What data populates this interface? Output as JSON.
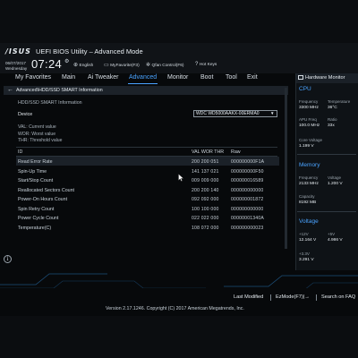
{
  "header": {
    "logo": "/ISUS",
    "title": "UEFI BIOS Utility – Advanced Mode",
    "date": "06/07/2017",
    "weekday": "Wednesday",
    "time": "07:24",
    "tools": [
      {
        "label": "English",
        "icon": "globe-icon"
      },
      {
        "label": "MyFavorite(F3)",
        "icon": "star-icon"
      },
      {
        "label": "Qfan Control(F6)",
        "icon": "fan-icon"
      },
      {
        "label": "Hot Keys",
        "icon": "question-icon"
      }
    ]
  },
  "menu": {
    "items": [
      "My Favorites",
      "Main",
      "Ai Tweaker",
      "Advanced",
      "Monitor",
      "Boot",
      "Tool",
      "Exit"
    ],
    "active": "Advanced"
  },
  "breadcrumb": "Advanced\\HDD/SSD SMART Information",
  "section_title": "HDD/SSD SMART Information",
  "device": {
    "label": "Device",
    "value": "WDC WD5000AAKX-00ERMA0"
  },
  "legend": [
    "VAL: Current value",
    "WOR: Worst value",
    "THR: Threshold value"
  ],
  "table": {
    "headers": {
      "id": "ID",
      "vals": "VAL WOR THR",
      "raw": "Raw"
    },
    "rows": [
      {
        "name": "Read Error Rate",
        "vals": "200 200 051",
        "raw": "000000000F1A"
      },
      {
        "name": "Spin-Up Time",
        "vals": "141 137 021",
        "raw": "000000000F50"
      },
      {
        "name": "Start/Stop Count",
        "vals": "009 009 000",
        "raw": "000000016589"
      },
      {
        "name": "Reallocated Sectors Count",
        "vals": "200 200 140",
        "raw": "000000000000"
      },
      {
        "name": "Power-On Hours Count",
        "vals": "092 092 000",
        "raw": "000000001872"
      },
      {
        "name": "Spin Retry Count",
        "vals": "100 100 000",
        "raw": "000000000000"
      },
      {
        "name": "Power Cycle Count",
        "vals": "022 022 000",
        "raw": "00000001340A"
      },
      {
        "name": "Temperature(C)",
        "vals": "108 072 000",
        "raw": "000000000023"
      }
    ]
  },
  "hardware_monitor": {
    "title": "Hardware Monitor",
    "cpu": {
      "title": "CPU",
      "frequency_label": "Frequency",
      "frequency": "3300 MHz",
      "temperature_label": "Temperature",
      "temperature": "36°C",
      "apu_freq_label": "APU Freq",
      "apu_freq": "100.0 MHz",
      "ratio_label": "Ratio",
      "ratio": "33x",
      "core_voltage_label": "Core Voltage",
      "core_voltage": "1.199 V"
    },
    "memory": {
      "title": "Memory",
      "frequency_label": "Frequency",
      "frequency": "2133 MHz",
      "voltage_label": "Voltage",
      "voltage": "1.200 V",
      "capacity_label": "Capacity",
      "capacity": "8192 MB"
    },
    "voltage": {
      "title": "Voltage",
      "v12_label": "+12V",
      "v12": "12.164 V",
      "v5_label": "+5V",
      "v5": "4.986 V",
      "v33_label": "+3.3V",
      "v33": "3.291 V"
    }
  },
  "footer": {
    "last_modified": "Last Modified",
    "ezmode": "EzMode(F7)|→",
    "search": "Search on FAQ",
    "copyright": "Version 2.17.1246. Copyright (C) 2017 American Megatrends, Inc."
  },
  "colors": {
    "accent": "#4aa3ff",
    "background": "#07090b",
    "panel": "#0e1216"
  }
}
